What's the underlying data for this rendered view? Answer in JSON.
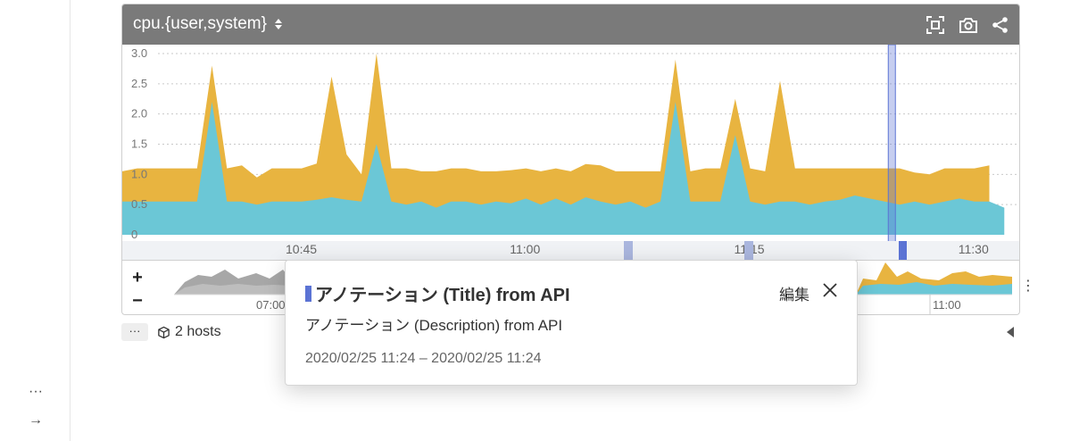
{
  "panel": {
    "title": "cpu.{user,system}",
    "icons": [
      "fullscreen-icon",
      "camera-icon",
      "share-icon"
    ]
  },
  "colors": {
    "user": "#e8b440",
    "system": "#6bc7d6",
    "header": "#7a7a7a",
    "annotation": "#5b73d4",
    "navigator_gray": "#a7a7a7"
  },
  "navigator": {
    "zoom_in": "+",
    "zoom_out": "−",
    "time_labels": [
      "07:00",
      "11:00"
    ]
  },
  "footer": {
    "ellipsis": "···",
    "hosts_label": "2 hosts"
  },
  "sidebar": {
    "more": "···",
    "expand": "→"
  },
  "annotation": {
    "title": "アノテーション (Title) from API",
    "description": "アノテーション (Description) from API",
    "period": "2020/02/25 11:24 – 2020/02/25 11:24",
    "edit_label": "編集"
  },
  "chart_data": {
    "type": "area",
    "stacked": true,
    "x_tick_labels": [
      "10:45",
      "11:00",
      "11:15",
      "11:30"
    ],
    "x_tick_minutes": [
      45,
      60,
      75,
      90
    ],
    "x_range_minutes": [
      33,
      93
    ],
    "ylim": [
      0,
      3.0
    ],
    "y_ticks": [
      0,
      0.5,
      1.0,
      1.5,
      2.0,
      2.5,
      3.0
    ],
    "y_tick_labels": [
      "0",
      "0.5",
      "1.0",
      "1.5",
      "2.0",
      "2.5",
      "3.0"
    ],
    "grid": true,
    "series": [
      {
        "name": "system",
        "color": "#6bc7d6",
        "x": [
          33,
          34,
          35,
          36,
          37,
          38,
          39,
          40,
          41,
          42,
          43,
          44,
          45,
          46,
          47,
          48,
          49,
          50,
          51,
          52,
          53,
          54,
          55,
          56,
          57,
          58,
          59,
          60,
          61,
          62,
          63,
          64,
          65,
          66,
          67,
          68,
          69,
          70,
          71,
          72,
          73,
          74,
          75,
          76,
          77,
          78,
          79,
          80,
          81,
          82,
          83,
          84,
          85,
          86,
          87,
          88,
          89,
          90,
          91,
          92
        ],
        "values": [
          0.55,
          0.55,
          0.55,
          0.55,
          0.55,
          0.55,
          2.2,
          0.55,
          0.55,
          0.5,
          0.55,
          0.55,
          0.55,
          0.58,
          0.62,
          0.58,
          0.55,
          1.5,
          0.55,
          0.5,
          0.55,
          0.45,
          0.55,
          0.55,
          0.5,
          0.55,
          0.52,
          0.6,
          0.5,
          0.6,
          0.5,
          0.62,
          0.55,
          0.5,
          0.55,
          0.45,
          0.55,
          2.2,
          0.55,
          0.55,
          0.55,
          1.65,
          0.55,
          0.5,
          0.55,
          0.55,
          0.5,
          0.55,
          0.58,
          0.65,
          0.6,
          0.55,
          0.5,
          0.55,
          0.5,
          0.55,
          0.6,
          0.55,
          0.55,
          0.45
        ]
      },
      {
        "name": "user",
        "color": "#e8b440",
        "x": [
          33,
          34,
          35,
          36,
          37,
          38,
          39,
          40,
          41,
          42,
          43,
          44,
          45,
          46,
          47,
          48,
          49,
          50,
          51,
          52,
          53,
          54,
          55,
          56,
          57,
          58,
          59,
          60,
          61,
          62,
          63,
          64,
          65,
          66,
          67,
          68,
          69,
          70,
          71,
          72,
          73,
          74,
          75,
          76,
          77,
          78,
          79,
          80,
          81,
          82,
          83,
          84,
          85,
          86,
          87,
          88,
          89,
          90,
          91
        ],
        "values": [
          0.5,
          0.55,
          0.55,
          0.55,
          0.55,
          0.55,
          0.6,
          0.55,
          0.6,
          0.45,
          0.55,
          0.55,
          0.55,
          0.6,
          2.0,
          0.75,
          0.45,
          1.5,
          0.55,
          0.6,
          0.5,
          0.6,
          0.55,
          0.55,
          0.55,
          0.5,
          0.55,
          0.5,
          0.55,
          0.5,
          0.55,
          0.55,
          0.6,
          0.55,
          0.5,
          0.6,
          0.5,
          0.7,
          0.5,
          0.55,
          0.55,
          0.6,
          0.55,
          0.55,
          2.0,
          0.55,
          0.6,
          0.55,
          0.52,
          0.45,
          0.5,
          0.55,
          0.6,
          0.48,
          0.5,
          0.55,
          0.5,
          0.55,
          0.6
        ]
      }
    ],
    "annotations": [
      {
        "label": "アノテーション (Title) from API",
        "x_minutes": 84
      }
    ]
  }
}
